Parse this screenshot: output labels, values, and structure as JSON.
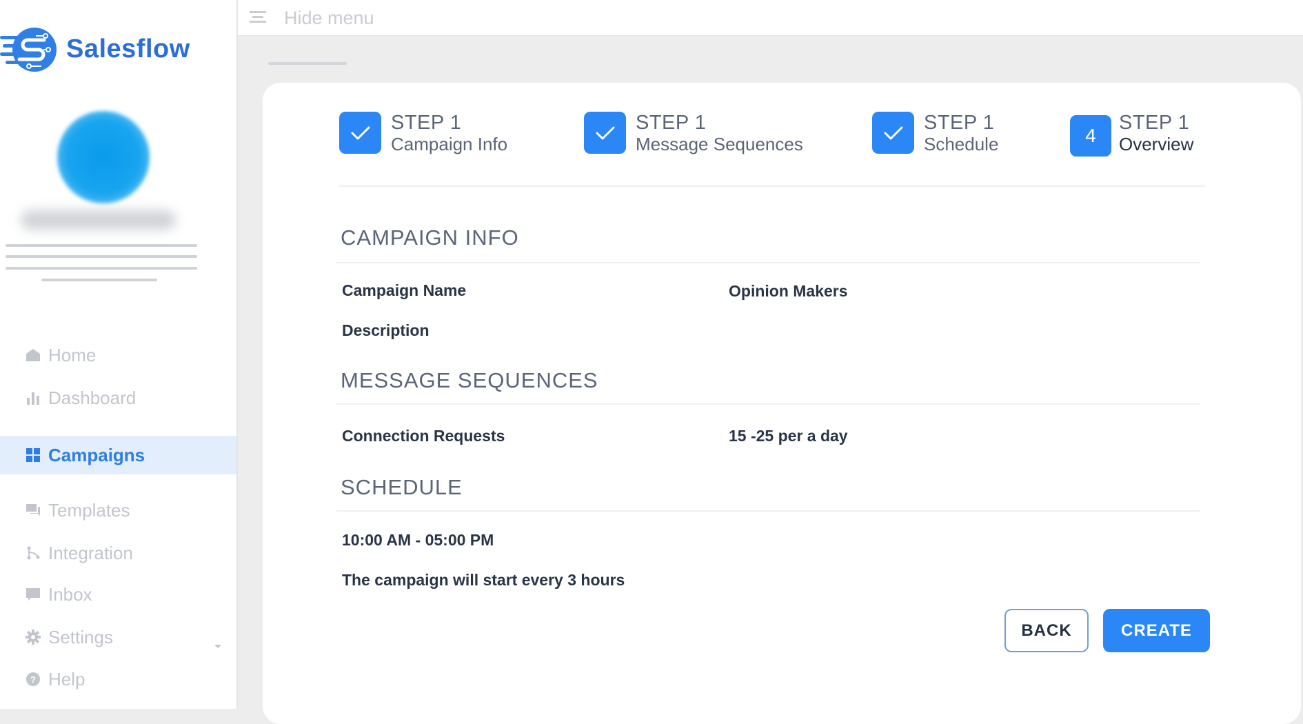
{
  "app": {
    "brand_name": "Salesflow",
    "accent_color": "#2b87f5"
  },
  "sidebar": {
    "user_name": "(blurred)",
    "items": [
      {
        "label": "Home",
        "icon": "home-icon"
      },
      {
        "label": "Dashboard",
        "icon": "bar-chart-icon"
      },
      {
        "label": "Campaigns",
        "icon": "grid-icon",
        "active": true
      },
      {
        "label": "Templates",
        "icon": "chat-bubbles-icon"
      },
      {
        "label": "Integration",
        "icon": "integration-icon"
      },
      {
        "label": "Inbox",
        "icon": "message-icon"
      },
      {
        "label": "Settings",
        "icon": "gear-icon",
        "has_submenu": true
      },
      {
        "label": "Help",
        "icon": "help-circle-icon"
      }
    ]
  },
  "header": {
    "hide_menu_label": "Hide menu"
  },
  "stepper": {
    "steps": [
      {
        "step_label": "STEP 1",
        "title": "Campaign Info",
        "status": "completed",
        "marker": "✓"
      },
      {
        "step_label": "STEP 1",
        "title": "Message Sequences",
        "status": "completed",
        "marker": "✓"
      },
      {
        "step_label": "STEP 1",
        "title": "Schedule",
        "status": "completed",
        "marker": "✓"
      },
      {
        "step_label": "STEP 1",
        "title": "Overview",
        "status": "current",
        "marker": "4"
      }
    ]
  },
  "overview": {
    "campaign_info": {
      "title": "CAMPAIGN INFO",
      "rows": [
        {
          "label": "Campaign Name",
          "value": "Opinion Makers"
        },
        {
          "label": "Description",
          "value": ""
        }
      ]
    },
    "message_sequences": {
      "title": "MESSAGE SEQUENCES",
      "rows": [
        {
          "label": "Connection Requests",
          "value": "15 -25 per a day"
        }
      ]
    },
    "schedule": {
      "title": "SCHEDULE",
      "time_range": "10:00 AM - 05:00 PM",
      "frequency": "The campaign will start every 3 hours"
    }
  },
  "actions": {
    "back_label": "BACK",
    "create_label": "CREATE"
  }
}
